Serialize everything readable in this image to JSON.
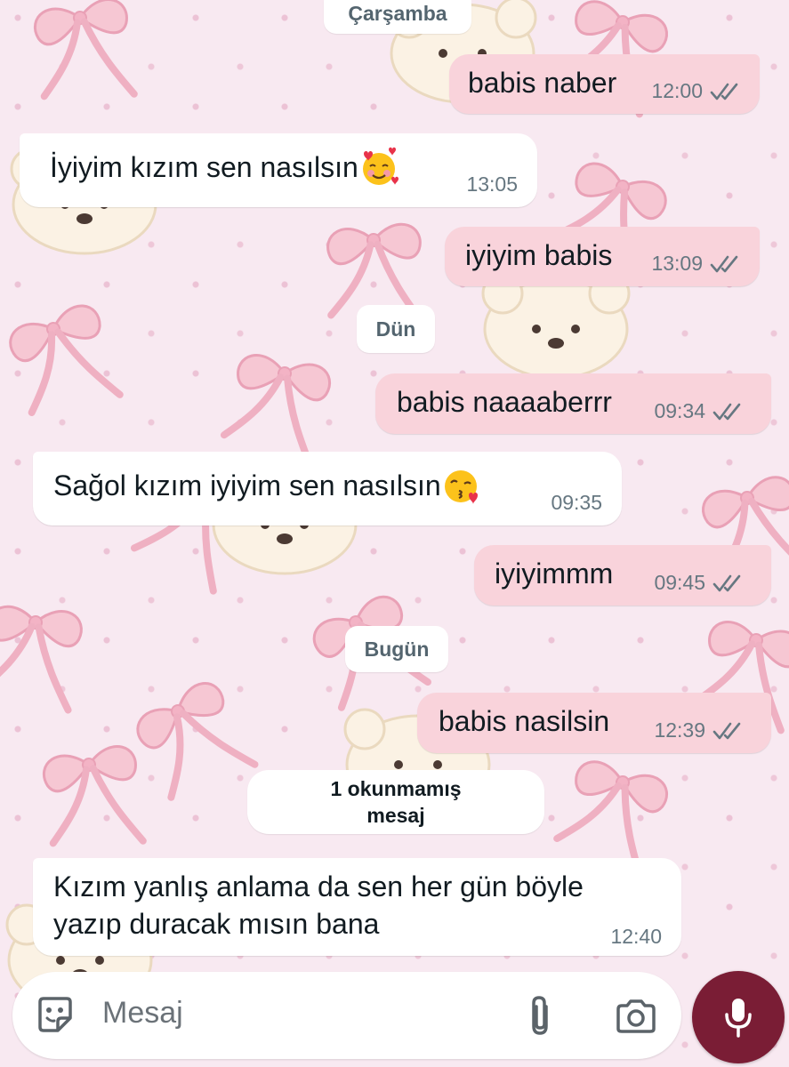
{
  "colors": {
    "outgoing_bubble": "#f9d3db",
    "incoming_bubble": "#ffffff",
    "wallpaper": "#f8e9f1",
    "mic_button": "#7a1d35",
    "read_ticks": "#667781"
  },
  "day_chips": {
    "wednesday": "Çarşamba",
    "yesterday": "Dün",
    "today": "Bugün"
  },
  "unread_banner": {
    "line1": "1 okunmamış",
    "line2": "mesaj"
  },
  "messages": [
    {
      "direction": "out",
      "text": "babis naber",
      "time": "12:00",
      "status": "read"
    },
    {
      "direction": "in",
      "text": "İyiyim kızım sen nasılsın",
      "emoji": "smiling-face-with-hearts",
      "time": "13:05"
    },
    {
      "direction": "out",
      "text": "iyiyim babis",
      "time": "13:09",
      "status": "read"
    },
    {
      "direction": "out",
      "text": "babis naaaaberrr",
      "time": "09:34",
      "status": "read"
    },
    {
      "direction": "in",
      "text": "Sağol kızım iyiyim sen nasılsın",
      "emoji": "face-blowing-a-kiss",
      "time": "09:35"
    },
    {
      "direction": "out",
      "text": "iyiyimmm",
      "time": "09:45",
      "status": "read"
    },
    {
      "direction": "out",
      "text": "babis nasilsin",
      "time": "12:39",
      "status": "read"
    },
    {
      "direction": "in",
      "lines": [
        "Kızım yanlış anlama da sen her gün böyle",
        "yazıp duracak mısın bana"
      ],
      "time": "12:40"
    }
  ],
  "composer": {
    "placeholder": "Mesaj",
    "icons": [
      "sticker-icon",
      "attachment-icon",
      "camera-icon",
      "microphone-icon"
    ]
  }
}
